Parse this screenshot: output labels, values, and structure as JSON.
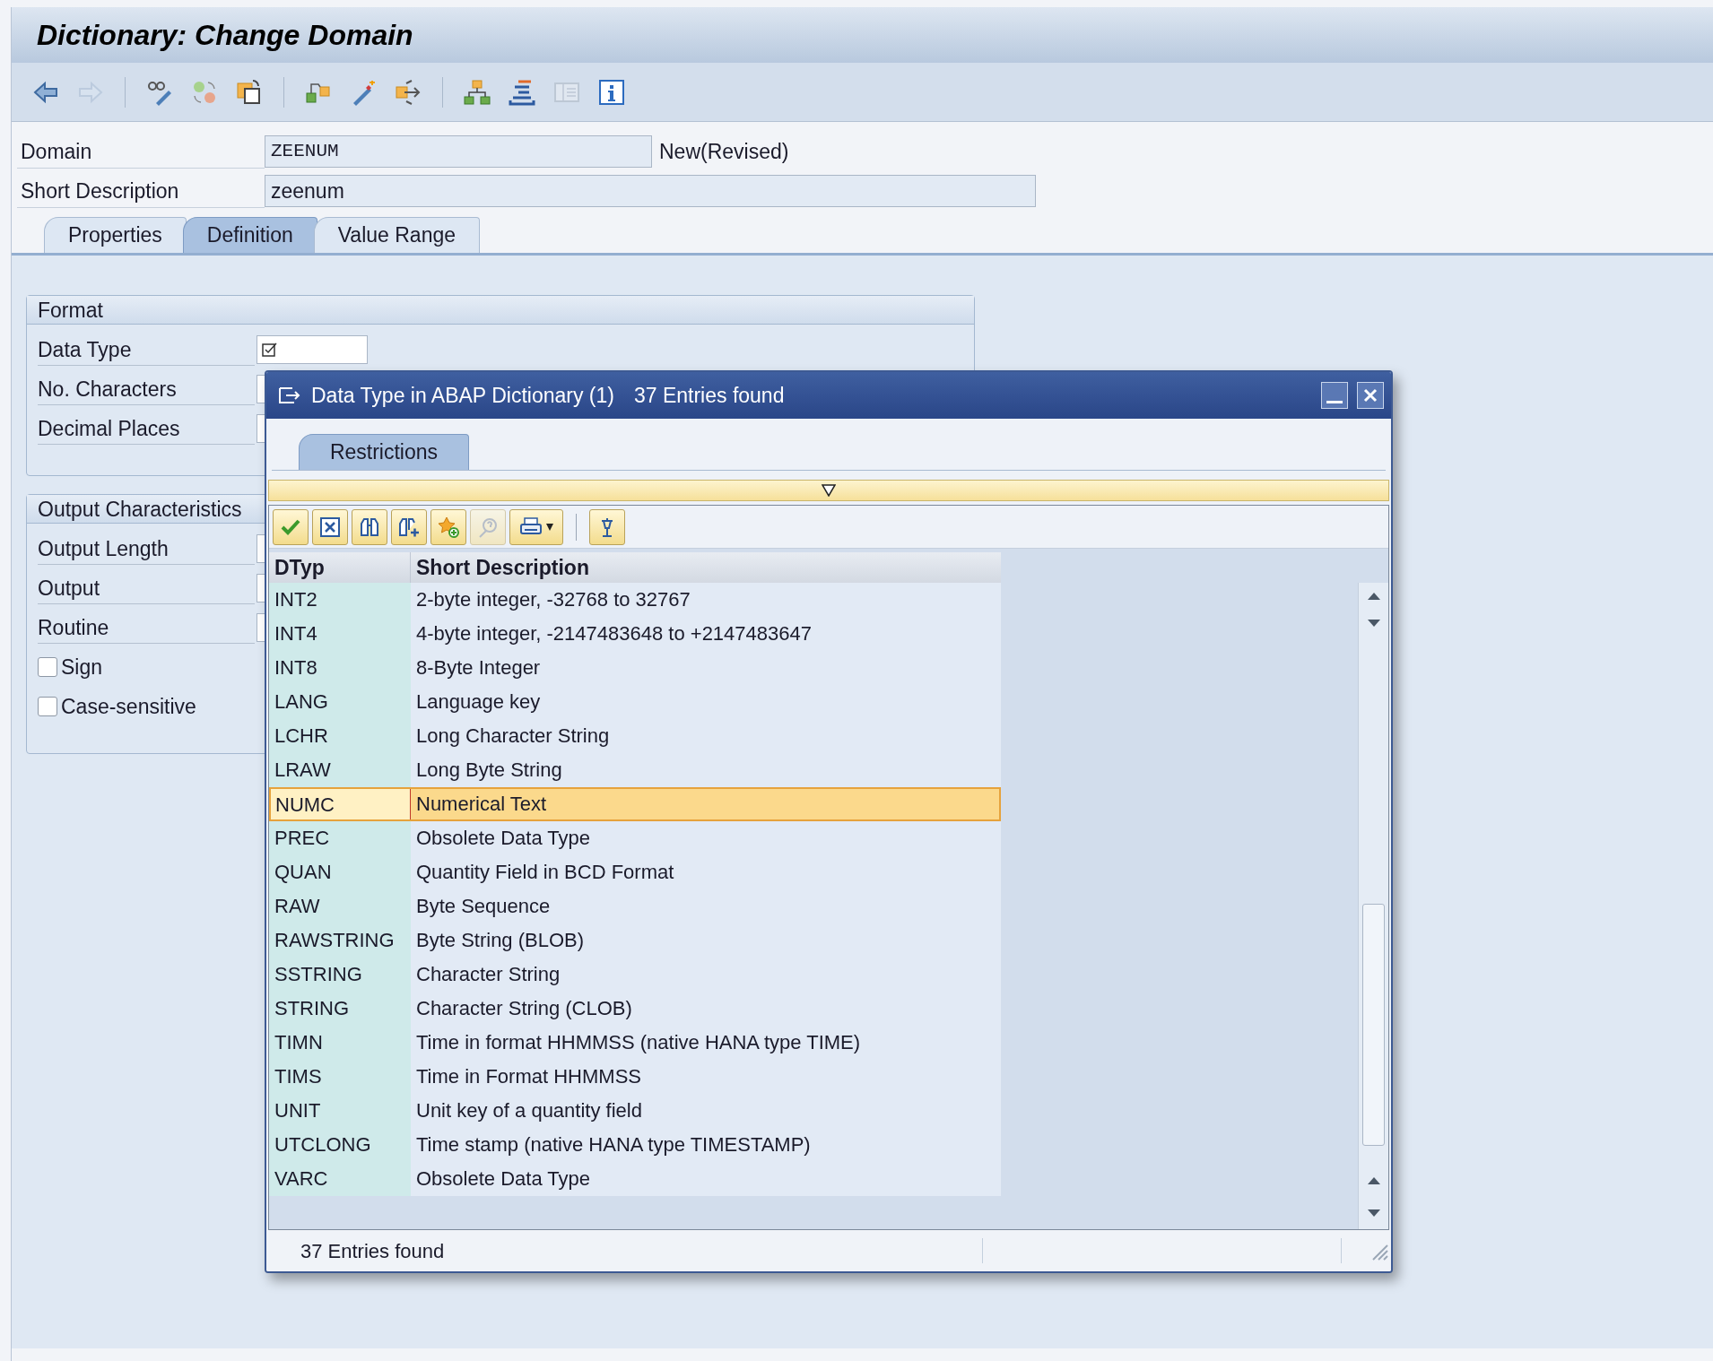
{
  "window": {
    "title": "Dictionary: Change Domain"
  },
  "toolbar": [
    {
      "kind": "back",
      "disabled": false
    },
    {
      "kind": "forward",
      "disabled": true
    },
    {
      "kind": "separator"
    },
    {
      "kind": "display_change",
      "disabled": false
    },
    {
      "kind": "toggle",
      "disabled": false
    },
    {
      "kind": "other_object",
      "disabled": false
    },
    {
      "kind": "separator"
    },
    {
      "kind": "where_used",
      "disabled": false
    },
    {
      "kind": "activate",
      "disabled": false
    },
    {
      "kind": "export",
      "disabled": false
    },
    {
      "kind": "separator"
    },
    {
      "kind": "hierarchy",
      "disabled": false
    },
    {
      "kind": "stack",
      "disabled": false
    },
    {
      "kind": "layout",
      "disabled": true
    },
    {
      "kind": "info",
      "disabled": false
    }
  ],
  "header_fields": [
    {
      "label": "Domain",
      "value": "ZEENUM",
      "status": "New(Revised)"
    },
    {
      "label": "Short Description",
      "value": "zeenum"
    }
  ],
  "tabs": [
    {
      "label": "Properties",
      "selected": false
    },
    {
      "label": "Definition",
      "selected": true
    },
    {
      "label": "Value Range",
      "selected": false
    }
  ],
  "format": {
    "title": "Format",
    "fields": [
      {
        "label": "Data Type"
      },
      {
        "label": "No. Characters"
      },
      {
        "label": "Decimal Places"
      }
    ]
  },
  "output_characteristics": {
    "title": "Output Characteristics",
    "fields": [
      {
        "label": "Output Length"
      },
      {
        "label": "Output"
      },
      {
        "label": "Routine"
      }
    ],
    "checkboxes": [
      {
        "label": "Sign",
        "checked": false
      },
      {
        "label": "Case-sensitive",
        "checked": false
      }
    ]
  },
  "dialog": {
    "title": "Data Type in ABAP Dictionary (1)",
    "count": "37 Entries found",
    "tabs": [
      {
        "label": "Restrictions",
        "selected": true
      }
    ],
    "toolbar": [
      {
        "kind": "accept",
        "disabled": false
      },
      {
        "kind": "cancel",
        "disabled": false
      },
      {
        "kind": "find",
        "disabled": false
      },
      {
        "kind": "find_next",
        "disabled": false
      },
      {
        "kind": "favorite",
        "disabled": false
      },
      {
        "kind": "help",
        "disabled": true
      },
      {
        "kind": "print",
        "disabled": false
      },
      {
        "kind": "separator"
      },
      {
        "kind": "pin",
        "disabled": false
      }
    ],
    "columns": [
      "DTyp",
      "Short Description"
    ],
    "rows": [
      {
        "dtyp": "INT2",
        "description": "2-byte integer, -32768 to 32767",
        "selected": false
      },
      {
        "dtyp": "INT4",
        "description": "4-byte integer, -2147483648 to +2147483647",
        "selected": false
      },
      {
        "dtyp": "INT8",
        "description": "8-Byte Integer",
        "selected": false
      },
      {
        "dtyp": "LANG",
        "description": "Language key",
        "selected": false
      },
      {
        "dtyp": "LCHR",
        "description": "Long Character String",
        "selected": false
      },
      {
        "dtyp": "LRAW",
        "description": "Long Byte String",
        "selected": false
      },
      {
        "dtyp": "NUMC",
        "description": "Numerical Text",
        "selected": true
      },
      {
        "dtyp": "PREC",
        "description": "Obsolete Data Type",
        "selected": false
      },
      {
        "dtyp": "QUAN",
        "description": "Quantity Field in BCD Format",
        "selected": false
      },
      {
        "dtyp": "RAW",
        "description": "Byte Sequence",
        "selected": false
      },
      {
        "dtyp": "RAWSTRING",
        "description": "Byte String (BLOB)",
        "selected": false
      },
      {
        "dtyp": "SSTRING",
        "description": "Character String",
        "selected": false
      },
      {
        "dtyp": "STRING",
        "description": "Character String (CLOB)",
        "selected": false
      },
      {
        "dtyp": "TIMN",
        "description": "Time in format HHMMSS (native HANA type TIME)",
        "selected": false
      },
      {
        "dtyp": "TIMS",
        "description": "Time in Format HHMMSS",
        "selected": false
      },
      {
        "dtyp": "UNIT",
        "description": "Unit key of a quantity field",
        "selected": false
      },
      {
        "dtyp": "UTCLONG",
        "description": "Time stamp (native HANA type TIMESTAMP)",
        "selected": false
      },
      {
        "dtyp": "VARC",
        "description": "Obsolete Data Type",
        "selected": false
      }
    ],
    "status": "37 Entries found"
  }
}
